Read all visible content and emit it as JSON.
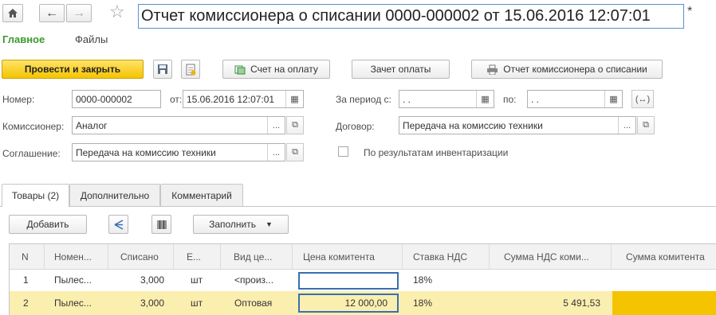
{
  "window": {
    "title": "Отчет комиссионера о списании 0000-000002 от 15.06.2016 12:07:01",
    "modified_mark": "*"
  },
  "nav": {
    "main": "Главное",
    "files": "Файлы"
  },
  "toolbar": {
    "post_close": "Провести и закрыть",
    "invoice": "Счет на оплату",
    "offset": "Зачет оплаты",
    "report": "Отчет комиссионера о списании"
  },
  "form": {
    "number_label": "Номер:",
    "number_value": "0000-000002",
    "date_label": "от:",
    "date_value": "15.06.2016 12:07:01",
    "period_from_label": "За период с:",
    "period_from_value": " .  .",
    "period_to_label": "по:",
    "period_to_value": " .  .",
    "commissioner_label": "Комиссионер:",
    "commissioner_value": "Аналог",
    "agreement_label": "Соглашение:",
    "agreement_value": "Передача на комиссию техники",
    "contract_label": "Договор:",
    "contract_value": "Передача на комиссию техники",
    "inventory_label": "По результатам инвентаризации",
    "inventory_checked": false
  },
  "tabs": [
    {
      "label": "Товары (2)"
    },
    {
      "label": "Дополнительно"
    },
    {
      "label": "Комментарий"
    }
  ],
  "table_toolbar": {
    "add": "Добавить",
    "fill": "Заполнить"
  },
  "table": {
    "headers": [
      "N",
      "Номен...",
      "Списано",
      "Е...",
      "Вид це...",
      "Цена комитента",
      "Ставка НДС",
      "Сумма НДС коми...",
      "Сумма комитента"
    ],
    "rows": [
      {
        "n": "1",
        "nom": "Пылес...",
        "qty": "3,000",
        "unit": "шт",
        "price_type": "<произ...",
        "price": "",
        "vat_rate": "18%",
        "vat_sum": "",
        "sum": ""
      },
      {
        "n": "2",
        "nom": "Пылес...",
        "qty": "3,000",
        "unit": "шт",
        "price_type": "Оптовая",
        "price": "12 000,00",
        "vat_rate": "18%",
        "vat_sum": "5 491,53",
        "sum": ""
      }
    ]
  },
  "colors": {
    "accent": "#f5c400",
    "nav_green": "#3c9a2f",
    "selected_row": "#fbefb0",
    "focus": "#3a6fb0"
  }
}
